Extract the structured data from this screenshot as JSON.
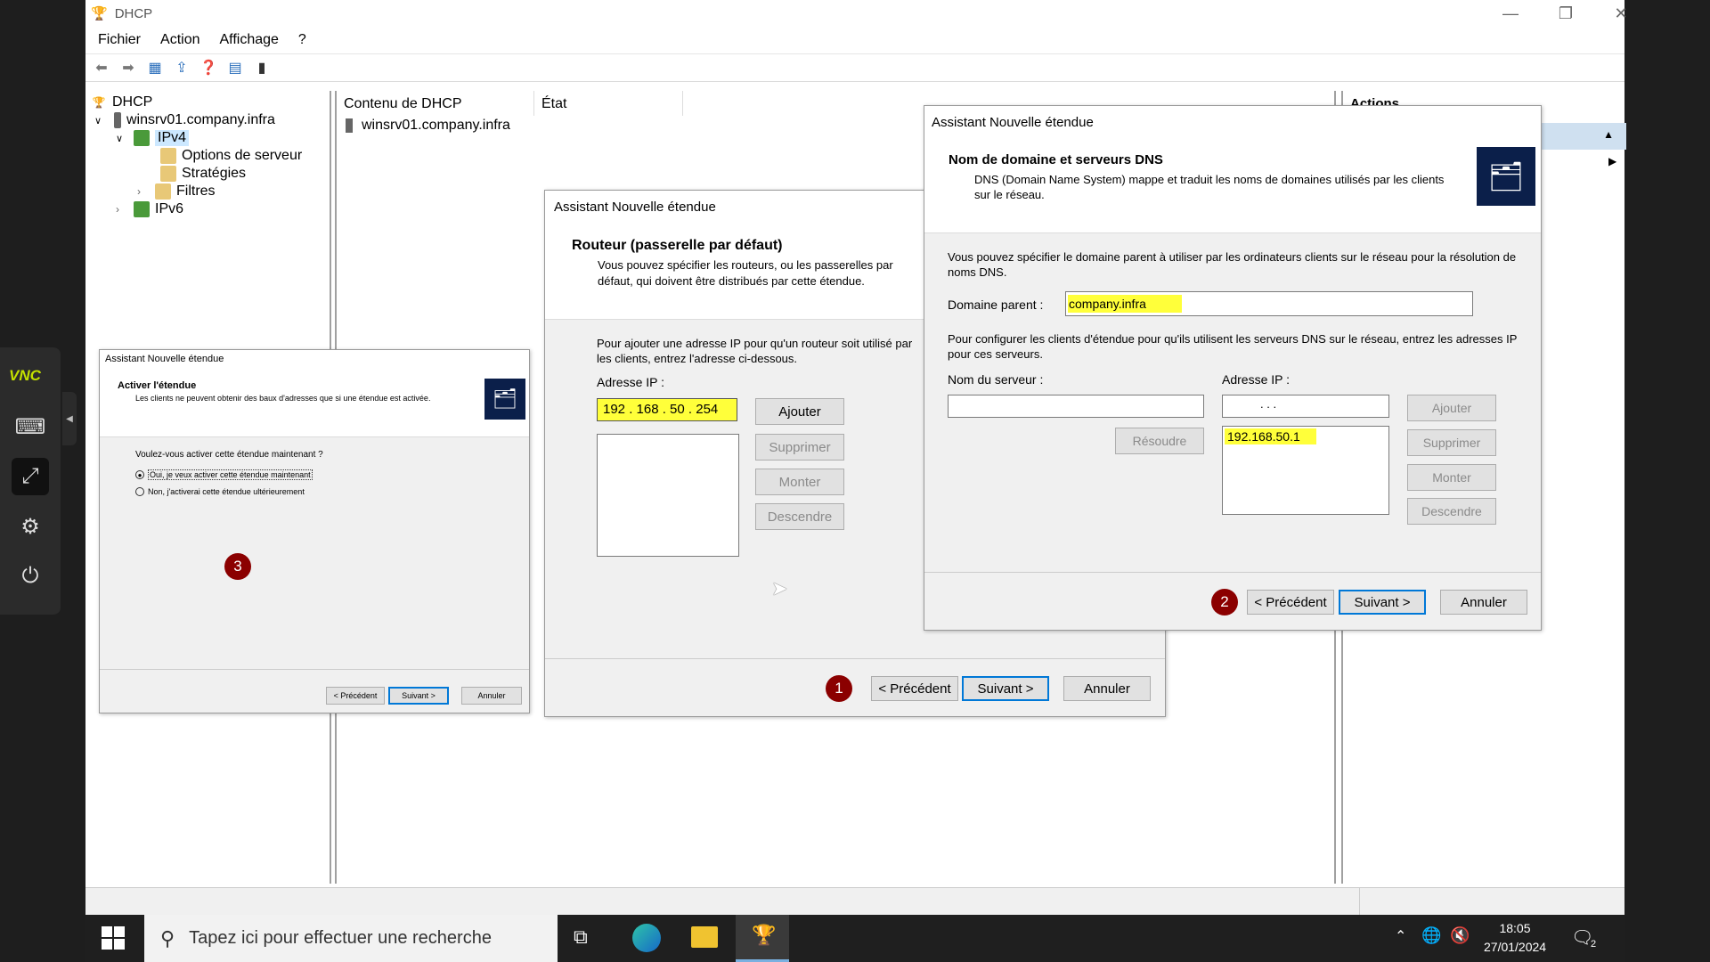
{
  "window": {
    "title": "DHCP"
  },
  "menu": [
    "Fichier",
    "Action",
    "Affichage",
    "?"
  ],
  "tree": {
    "root": "DHCP",
    "server": "winsrv01.company.infra",
    "ipv4": "IPv4",
    "options": "Options de serveur",
    "strategies": "Stratégies",
    "filters": "Filtres",
    "ipv6": "IPv6"
  },
  "content": {
    "col1": "Contenu de DHCP",
    "col2": "État",
    "row1": "winsrv01.company.infra"
  },
  "actions": {
    "title": "Actions"
  },
  "wizard_router": {
    "title": "Assistant Nouvelle étendue",
    "heading": "Routeur (passerelle par défaut)",
    "subheading": "Vous pouvez spécifier les routeurs, ou les passerelles par défaut, qui doivent être distribués par cette étendue.",
    "instructions": "Pour ajouter une adresse IP pour qu'un routeur soit utilisé par les clients, entrez l'adresse ci-dessous.",
    "ip_label": "Adresse IP :",
    "ip_value": "192 . 168 . 50 . 254",
    "add": "Ajouter",
    "remove": "Supprimer",
    "up": "Monter",
    "down": "Descendre",
    "prev": "< Précédent",
    "next": "Suivant >",
    "cancel": "Annuler",
    "badge": "1"
  },
  "wizard_dns": {
    "title": "Assistant Nouvelle étendue",
    "heading": "Nom de domaine et serveurs DNS",
    "subheading": "DNS (Domain Name System) mappe et traduit les noms de domaines utilisés par les clients sur le réseau.",
    "parent_info": "Vous pouvez spécifier le domaine parent à utiliser par les ordinateurs clients sur le réseau pour la résolution de noms DNS.",
    "parent_label": "Domaine parent :",
    "parent_value": "company.infra",
    "servers_info": "Pour configurer les clients d'étendue pour qu'ils utilisent les serveurs DNS sur le réseau, entrez les adresses IP pour ces serveurs.",
    "server_name_label": "Nom du serveur :",
    "ip_label": "Adresse IP :",
    "ip_placeholder": ".        .        .",
    "resolve": "Résoudre",
    "dns_entry": "192.168.50.1",
    "add": "Ajouter",
    "remove": "Supprimer",
    "up": "Monter",
    "down": "Descendre",
    "prev": "< Précédent",
    "next": "Suivant >",
    "cancel": "Annuler",
    "badge": "2"
  },
  "wizard_activate": {
    "title": "Assistant Nouvelle étendue",
    "heading": "Activer l'étendue",
    "subheading": "Les clients ne peuvent obtenir des baux d'adresses que si une étendue est activée.",
    "question": "Voulez-vous activer cette étendue maintenant ?",
    "option_yes": "Oui, je veux activer cette étendue maintenant",
    "option_no": "Non, j'activerai cette étendue ultérieurement",
    "prev": "< Précédent",
    "next": "Suivant >",
    "cancel": "Annuler",
    "badge": "3"
  },
  "taskbar": {
    "search_placeholder": "Tapez ici pour effectuer une recherche",
    "time": "18:05",
    "date": "27/01/2024",
    "notif_count": "2"
  },
  "vnc": {
    "logo": "VNC"
  }
}
